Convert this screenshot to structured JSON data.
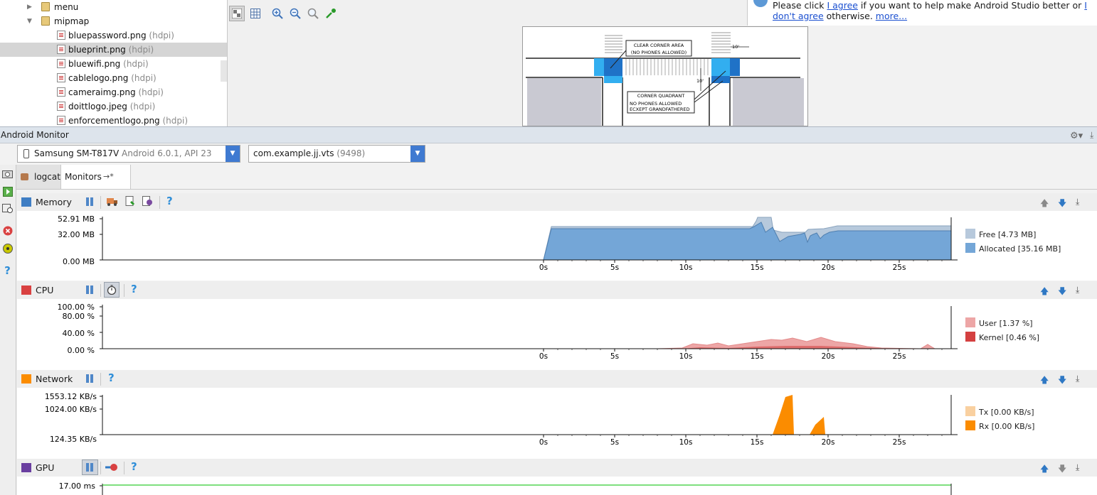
{
  "tree": {
    "folders": [
      {
        "label": "menu",
        "expanded": false
      },
      {
        "label": "mipmap",
        "expanded": true
      }
    ],
    "files": [
      {
        "name": "bluepassword.png",
        "qualifier": "(hdpi)"
      },
      {
        "name": "blueprint.png",
        "qualifier": "(hdpi)",
        "selected": true
      },
      {
        "name": "bluewifi.png",
        "qualifier": "(hdpi)"
      },
      {
        "name": "cablelogo.png",
        "qualifier": "(hdpi)"
      },
      {
        "name": "cameraimg.png",
        "qualifier": "(hdpi)"
      },
      {
        "name": "doittlogo.jpeg",
        "qualifier": "(hdpi)"
      },
      {
        "name": "enforcementlogo.png",
        "qualifier": "(hdpi)"
      }
    ]
  },
  "blueprint": {
    "label1a": "CLEAR CORNER AREA",
    "label1b": "(NO PHONES ALLOWED)",
    "label2a": "CORNER QUADRANT",
    "label2b": "NO PHONES ALLOWED",
    "label2c": "ECXEPT GRANDFATHERED",
    "dim1": "10'",
    "dim2": "10'"
  },
  "notification": {
    "prefix": "Please click ",
    "agree": "I agree",
    "middle": " if you want to help make Android Studio better or ",
    "dont": "I don't agree",
    "suffix": " otherwise. ",
    "more": "more..."
  },
  "monitor": {
    "title": "Android Monitor",
    "device": {
      "name": "Samsung SM-T817V",
      "detail": " Android 6.0.1, API 23"
    },
    "process": {
      "name": "com.example.jj.vts",
      "pid": " (9498)"
    },
    "tabs": {
      "logcat": "logcat",
      "monitors": "Monitors",
      "monitors_suffix": "→*"
    }
  },
  "colors": {
    "mem_free": "#b7c9dc",
    "mem_alloc": "#74a6d7",
    "cpu_user": "#eda6a6",
    "cpu_kernel": "#d44040",
    "net_tx": "#f9d0a0",
    "net_rx": "#fb8c00",
    "gpu_line": "#33cc33"
  },
  "time_axis": {
    "ticks": [
      "0s",
      "5s",
      "10s",
      "15s",
      "20s",
      "25s"
    ],
    "tick_values": [
      0,
      5,
      10,
      15,
      20,
      25
    ],
    "max": 28.6
  },
  "memory": {
    "name": "Memory",
    "y_ticks": [
      "52.91 MB",
      "32.00 MB",
      "0.00 MB"
    ],
    "legend": [
      {
        "label": "Free [4.73 MB]",
        "key": "free"
      },
      {
        "label": "Allocated [35.16 MB]",
        "key": "alloc"
      }
    ]
  },
  "cpu": {
    "name": "CPU",
    "y_ticks": [
      "100.00 %",
      "80.00 %",
      "40.00 %",
      "0.00 %"
    ],
    "legend": [
      {
        "label": "User [1.37 %]",
        "key": "user"
      },
      {
        "label": "Kernel [0.46 %]",
        "key": "kernel"
      }
    ]
  },
  "network": {
    "name": "Network",
    "y_ticks": [
      "1553.12 KB/s",
      "1024.00 KB/s",
      "124.35 KB/s"
    ],
    "legend": [
      {
        "label": "Tx [0.00 KB/s]",
        "key": "tx"
      },
      {
        "label": "Rx [0.00 KB/s]",
        "key": "rx"
      }
    ]
  },
  "gpu": {
    "name": "GPU",
    "y_ticks": [
      "17.00 ms"
    ]
  }
}
